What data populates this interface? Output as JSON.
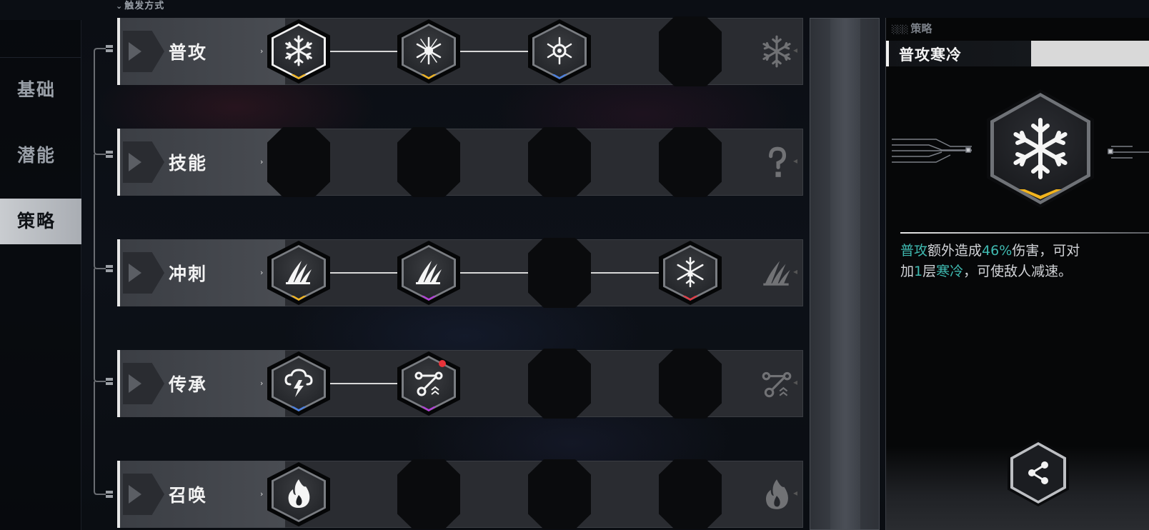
{
  "colors": {
    "accent_teal": "#3fb9b0",
    "rarity_gold": "#f2b41e",
    "rarity_blue": "#4a7fe0",
    "rarity_purple": "#b23fd6",
    "rarity_red": "#e23a45",
    "active_tab_bg": "#c9ccd0"
  },
  "header": {
    "trigger_label": "触发方式"
  },
  "nav": {
    "items": [
      "基础",
      "潜能",
      "策略"
    ],
    "active": "策略"
  },
  "rows": [
    {
      "label": "普攻",
      "ghost_icon": "snowflake-icon",
      "nodes": [
        {
          "icon": "snowflake-icon",
          "rarity": "gold",
          "selected": true
        },
        {
          "icon": "starburst-snowflake-icon",
          "rarity": "gold"
        },
        {
          "icon": "frost-core-icon",
          "rarity": "blue"
        }
      ]
    },
    {
      "label": "技能",
      "ghost_icon": "question-mark-icon",
      "nodes": []
    },
    {
      "label": "冲刺",
      "ghost_icon": "claw-slash-icon",
      "nodes": [
        {
          "icon": "claw-slash-icon",
          "rarity": "gold"
        },
        {
          "icon": "claw-slash-icon",
          "rarity": "purple"
        },
        {
          "icon": "frost-burst-icon",
          "rarity": "red"
        }
      ]
    },
    {
      "label": "传承",
      "ghost_icon": "branch-nodes-icon",
      "nodes": [
        {
          "icon": "thunder-cloud-icon",
          "rarity": "blue"
        },
        {
          "icon": "branch-nodes-icon",
          "rarity": "purple",
          "badge": true
        }
      ]
    },
    {
      "label": "召唤",
      "ghost_icon": "flame-icon",
      "nodes": [
        {
          "icon": "flame-icon",
          "rarity": "none"
        }
      ]
    }
  ],
  "detail": {
    "section_label": "策略",
    "title": "普攻寒冷",
    "icon": "snowflake-icon",
    "rarity": "gold",
    "desc_line1": {
      "p1": "普攻",
      "p2": "额外造成",
      "p3": "46%",
      "p4": "伤害，可对"
    },
    "desc_line2": {
      "p1": "加",
      "p2": "1",
      "p3": "层",
      "p4": "寒冷",
      "p5": "，可使敌人减速。"
    },
    "share_icon": "share-icon"
  }
}
